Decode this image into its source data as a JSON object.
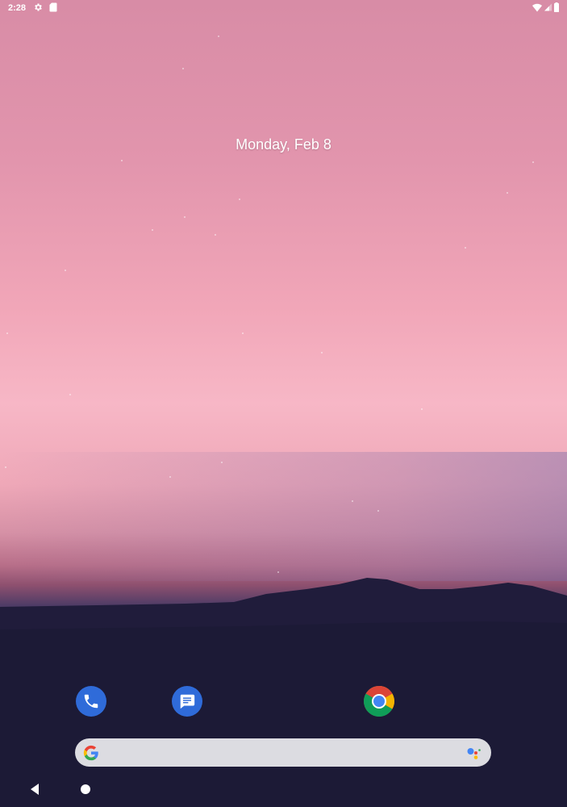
{
  "status_bar": {
    "time": "2:28",
    "left_icons": [
      "settings-gear-icon",
      "sd-card-icon"
    ],
    "right_icons": [
      "wifi-icon",
      "cell-signal-icon",
      "battery-icon"
    ]
  },
  "home": {
    "date": "Monday, Feb 8"
  },
  "dock": {
    "apps": [
      {
        "name": "Phone",
        "icon": "phone-icon",
        "color": "#2f6bd9"
      },
      {
        "name": "Messages",
        "icon": "messages-icon",
        "color": "#2f6bd9"
      },
      {
        "name": "Chrome",
        "icon": "chrome-icon"
      }
    ]
  },
  "search": {
    "logo": "google-g-icon",
    "assistant": "google-assistant-icon"
  },
  "nav": {
    "buttons": [
      "back-icon",
      "home-icon"
    ]
  },
  "colors": {
    "accent_blue": "#2f6bd9",
    "search_bg": "#dcdce1"
  }
}
